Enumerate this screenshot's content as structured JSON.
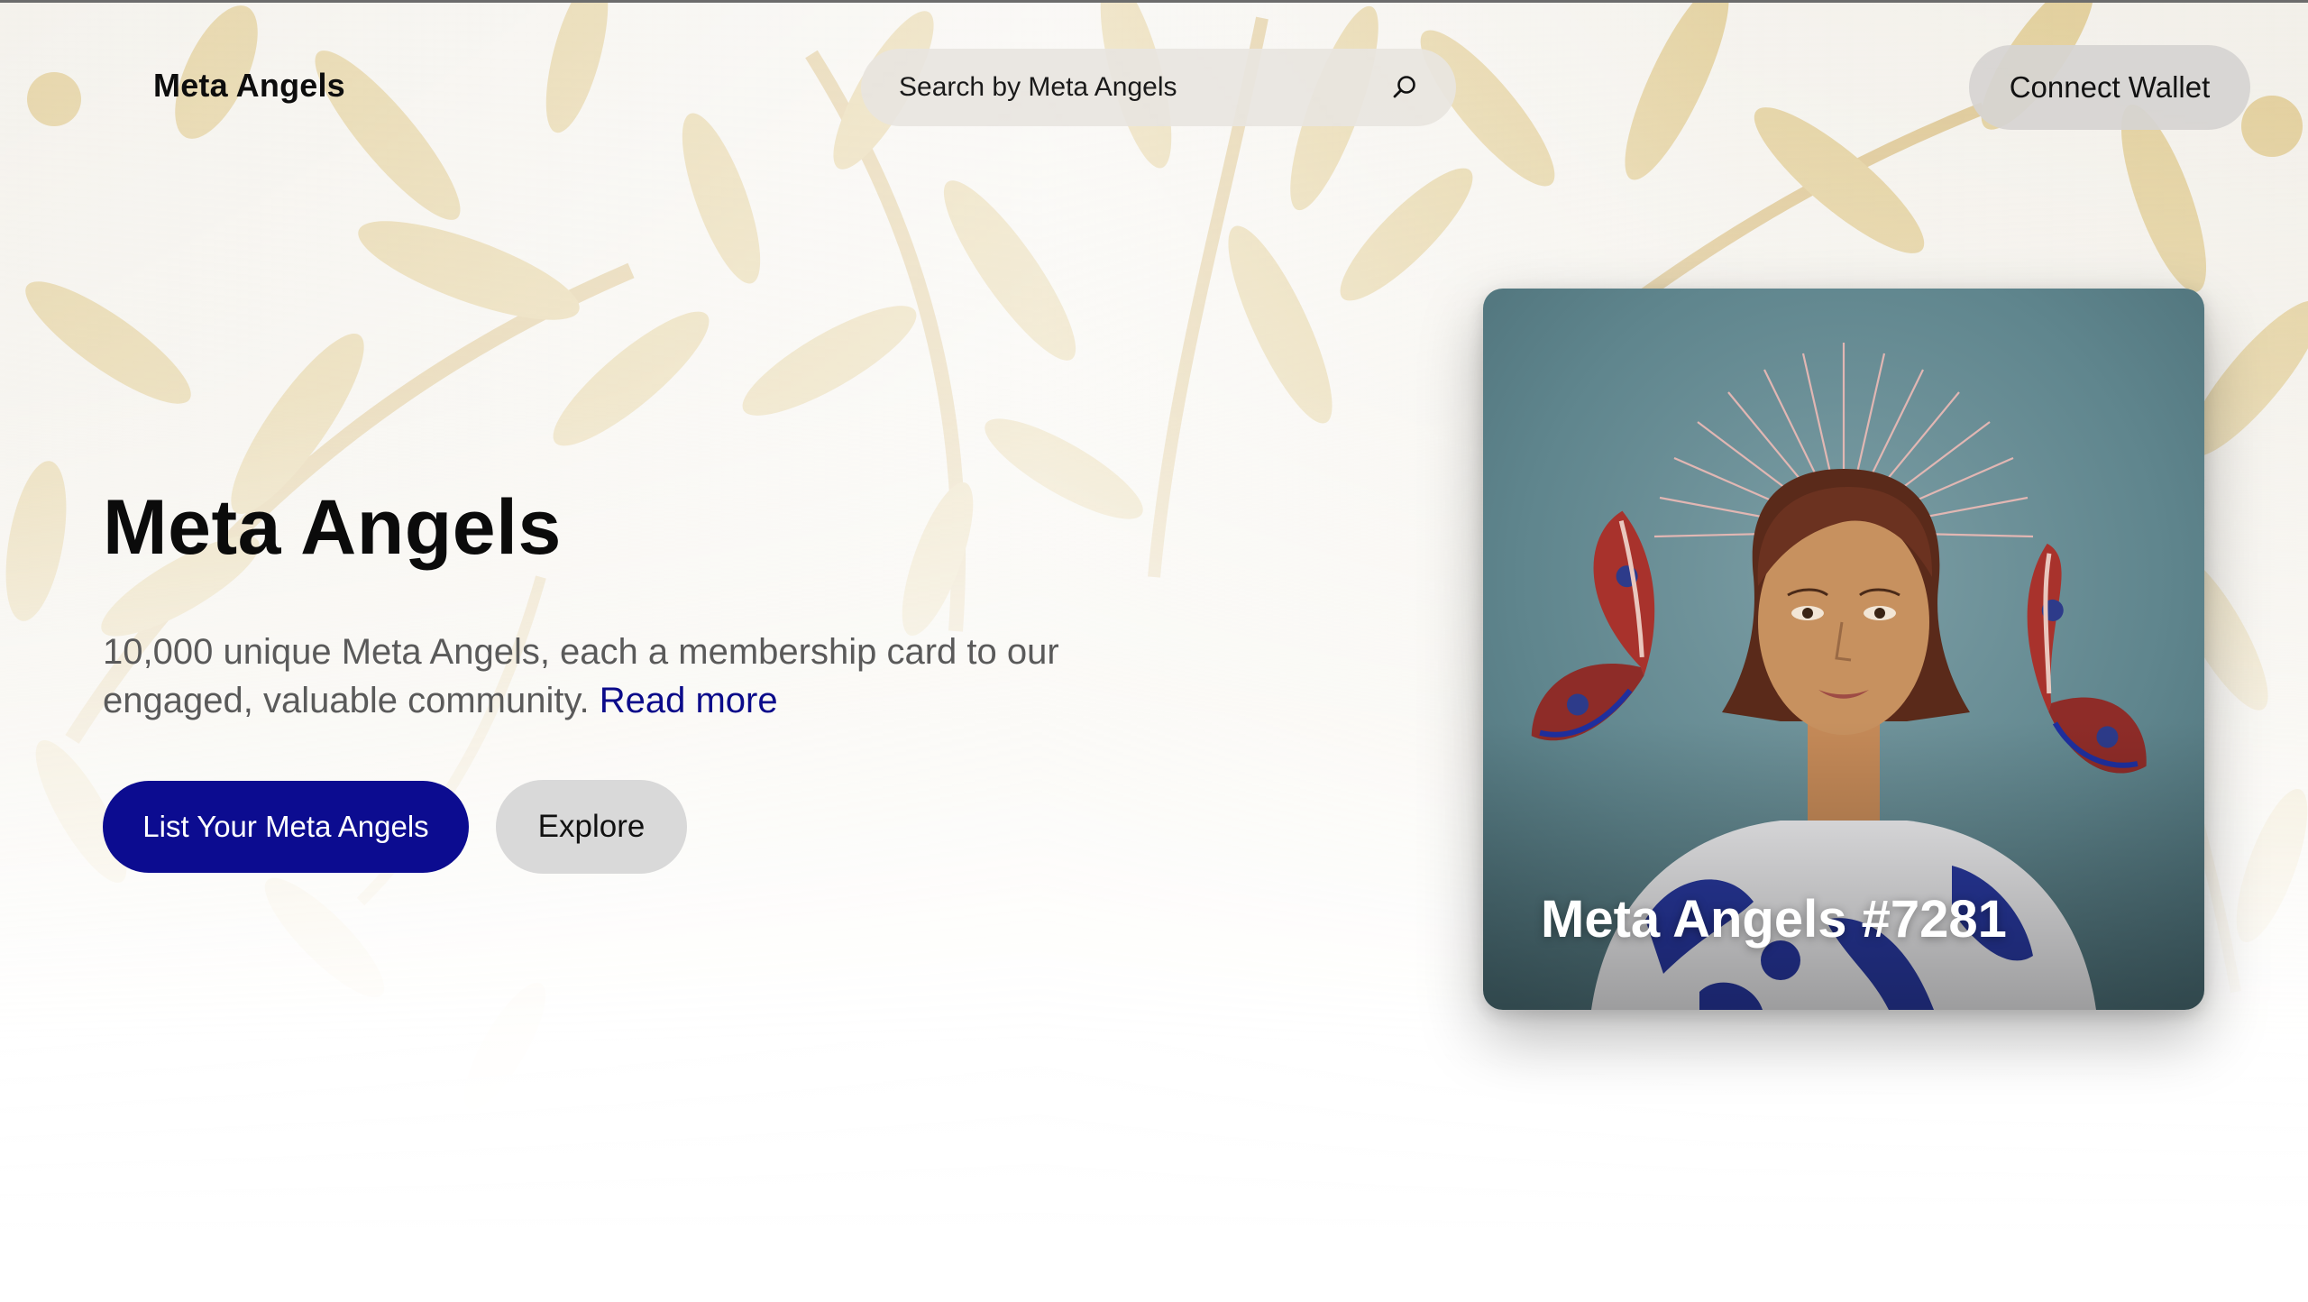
{
  "header": {
    "logo": "Meta Angels",
    "search_placeholder": "Search by Meta Angels",
    "search_icon": "search-icon",
    "connect_label": "Connect Wallet"
  },
  "hero": {
    "title": "Meta Angels",
    "description": "10,000 unique Meta Angels, each a membership card to our engaged, valuable community.",
    "read_more": "Read more",
    "primary_button": "List Your Meta Angels",
    "secondary_button": "Explore"
  },
  "card": {
    "title": "Meta Angels #7281"
  },
  "colors": {
    "primary": "#0c0c90",
    "link": "#0b0b8a",
    "leaf": "#c9a54a"
  }
}
